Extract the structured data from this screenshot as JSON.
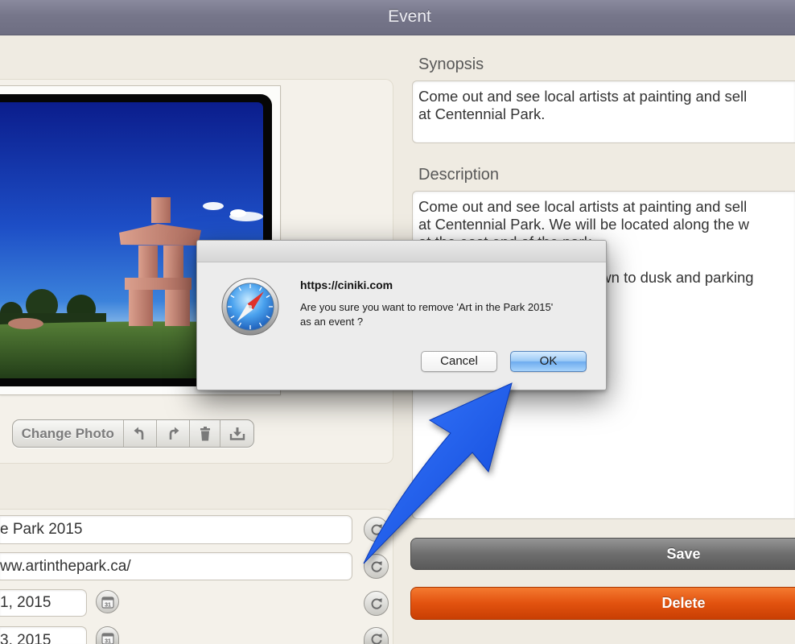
{
  "window": {
    "title": "Event"
  },
  "photo_toolbar": {
    "change_photo_label": "Change Photo",
    "icons": [
      "rotate-left-icon",
      "rotate-right-icon",
      "trash-icon",
      "download-icon"
    ]
  },
  "form": {
    "fields": [
      {
        "value": "e Park 2015",
        "reset_icon": "reset-icon"
      },
      {
        "value": "ww.artinthepark.ca/",
        "reset_icon": "reset-icon"
      },
      {
        "value": "1, 2015",
        "calendar_icon": "calendar-icon",
        "reset_icon": "reset-icon"
      },
      {
        "value": "3, 2015",
        "calendar_icon": "calendar-icon",
        "reset_icon": "reset-icon"
      }
    ],
    "calendar_glyph": "31"
  },
  "synopsis": {
    "label": "Synopsis",
    "lines": [
      "Come out and see local artists at painting and sell",
      "at Centennial Park."
    ]
  },
  "description": {
    "label": "Description",
    "lines": [
      "Come out and see local artists at painting and sell",
      "at Centennial Park. We will be located along the w",
      "at the east end of the park."
    ],
    "partial_line": "awn to dusk and parking"
  },
  "actions": {
    "save_label": "Save",
    "delete_label": "Delete"
  },
  "dialog": {
    "icon": "safari-compass-icon",
    "origin": "https://ciniki.com",
    "message_lines": [
      "Are you sure you want to remove 'Art in the Park 2015'",
      "as an event ?"
    ],
    "cancel_label": "Cancel",
    "ok_label": "OK"
  },
  "annotation": {
    "icon": "arrow-icon"
  },
  "colors": {
    "title_bar": "#78788c",
    "background": "#efebe2",
    "save_button": "#6e6e6e",
    "delete_button": "#e2520f",
    "ok_button": "#6eacef",
    "annotation_arrow": "#1f5ff0"
  }
}
